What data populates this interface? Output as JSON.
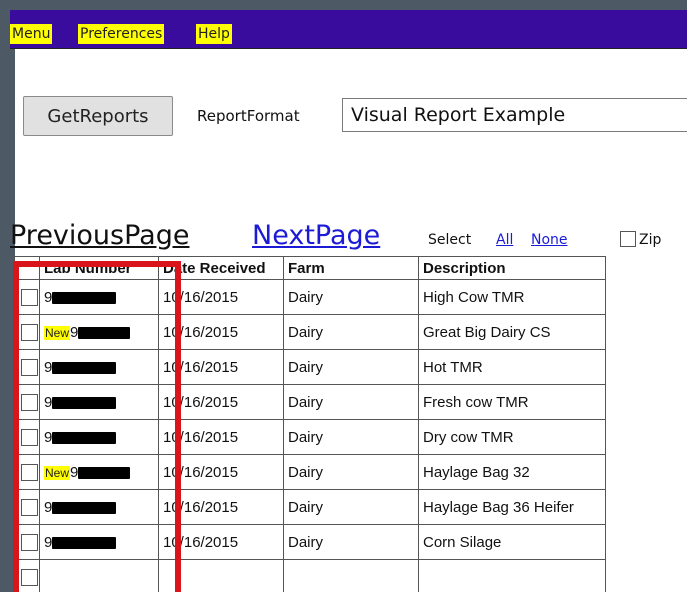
{
  "menu": {
    "items": [
      {
        "label": "Menu"
      },
      {
        "label": "Preferences"
      },
      {
        "label": "Help"
      }
    ]
  },
  "toolbar": {
    "get_reports_label": "GetReports",
    "report_format_label": "ReportFormat",
    "report_format_value": "Visual Report Example"
  },
  "pager": {
    "previous_label": "PreviousPage",
    "next_label": "NextPage",
    "select_label": "Select",
    "all_label": "All",
    "none_label": "None",
    "zip_label": "Zip"
  },
  "table": {
    "headers": [
      "Lab Number",
      "Date Received",
      "Farm",
      "Description"
    ],
    "rows": [
      {
        "is_new": false,
        "new_label": "",
        "lab_prefix": "9",
        "date": "10/16/2015",
        "farm": "Dairy",
        "description": "High Cow TMR"
      },
      {
        "is_new": true,
        "new_label": "New",
        "lab_prefix": "9",
        "date": "10/16/2015",
        "farm": "Dairy",
        "description": "Great Big Dairy CS"
      },
      {
        "is_new": false,
        "new_label": "",
        "lab_prefix": "9",
        "date": "10/16/2015",
        "farm": "Dairy",
        "description": "Hot TMR"
      },
      {
        "is_new": false,
        "new_label": "",
        "lab_prefix": "9",
        "date": "10/16/2015",
        "farm": "Dairy",
        "description": "Fresh cow TMR"
      },
      {
        "is_new": false,
        "new_label": "",
        "lab_prefix": "9",
        "date": "10/16/2015",
        "farm": "Dairy",
        "description": "Dry cow TMR"
      },
      {
        "is_new": true,
        "new_label": "New",
        "lab_prefix": "9",
        "date": "10/16/2015",
        "farm": "Dairy",
        "description": "Haylage Bag 32"
      },
      {
        "is_new": false,
        "new_label": "",
        "lab_prefix": "9",
        "date": "10/16/2015",
        "farm": "Dairy",
        "description": "Haylage Bag 36 Heifer"
      },
      {
        "is_new": false,
        "new_label": "",
        "lab_prefix": "9",
        "date": "10/16/2015",
        "farm": "Dairy",
        "description": "Corn Silage"
      }
    ]
  },
  "colors": {
    "menu_bar": "#3a0c9e",
    "menu_item_highlight": "#ffff00",
    "link": "#1b1bd6",
    "annotation_box": "#d9151b",
    "outer_frame": "#4d5a66"
  }
}
